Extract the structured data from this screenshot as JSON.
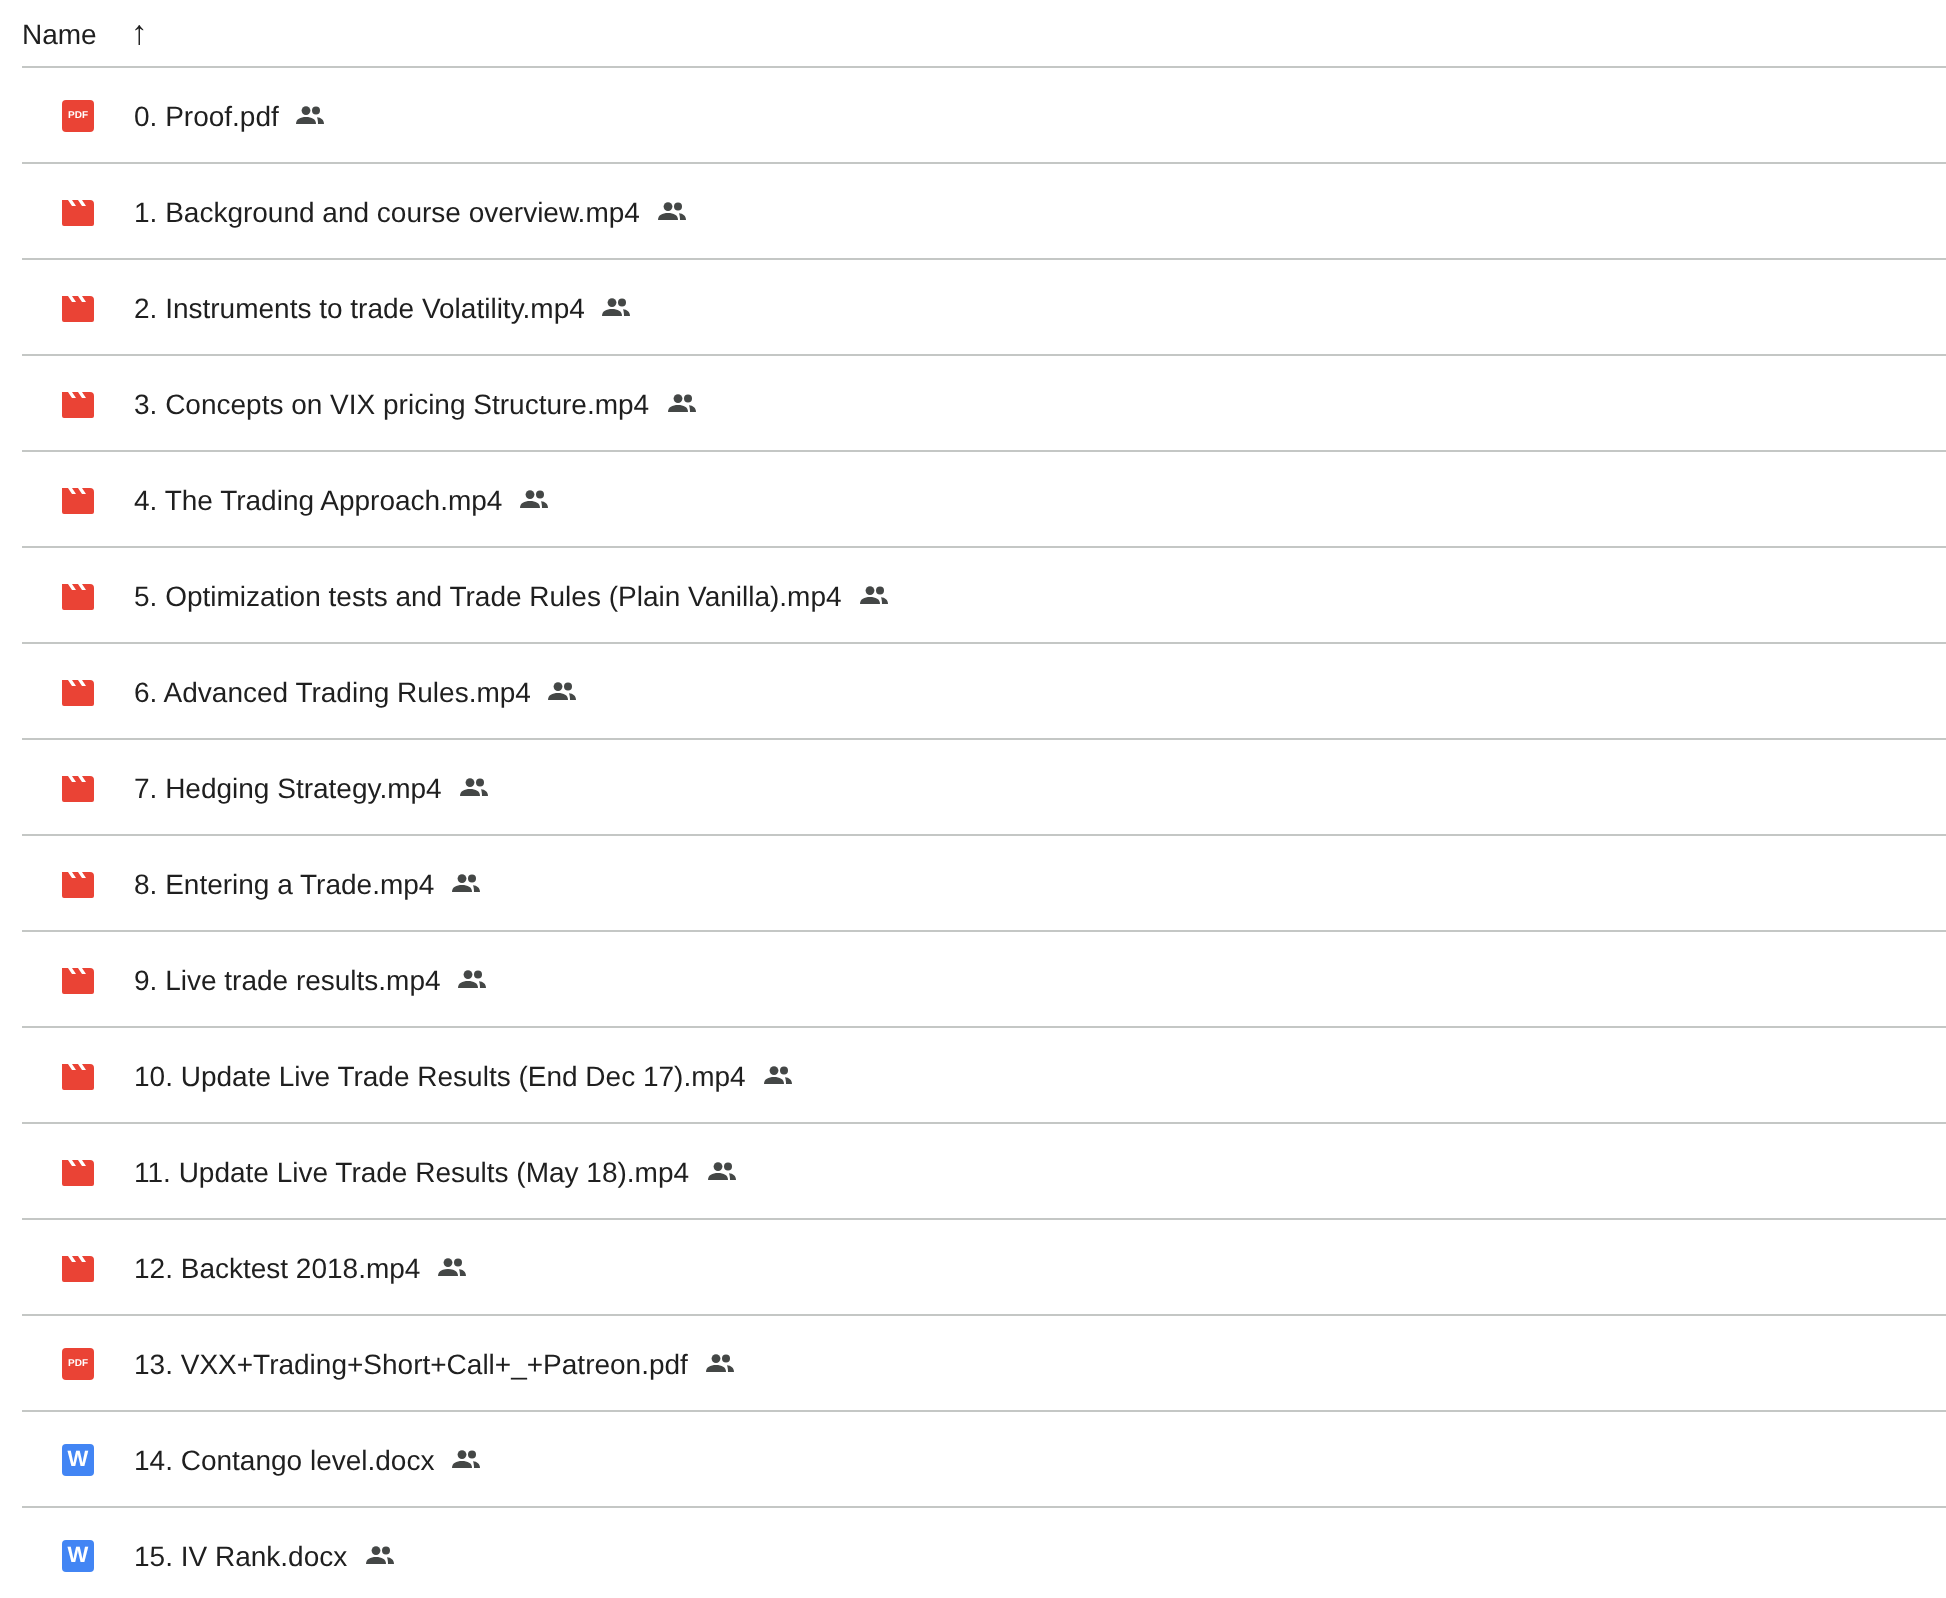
{
  "header": {
    "label": "Name",
    "sort_arrow": "↑"
  },
  "files": [
    {
      "kind": "pdf",
      "badge": "PDF",
      "name": "0. Proof.pdf",
      "shared": true
    },
    {
      "kind": "video",
      "name": "1. Background and course overview.mp4",
      "shared": true
    },
    {
      "kind": "video",
      "name": "2. Instruments to trade Volatility.mp4",
      "shared": true
    },
    {
      "kind": "video",
      "name": "3. Concepts on VIX pricing Structure.mp4",
      "shared": true
    },
    {
      "kind": "video",
      "name": "4. The Trading Approach.mp4",
      "shared": true
    },
    {
      "kind": "video",
      "name": "5. Optimization tests and Trade Rules (Plain Vanilla).mp4",
      "shared": true
    },
    {
      "kind": "video",
      "name": "6. Advanced Trading Rules.mp4",
      "shared": true
    },
    {
      "kind": "video",
      "name": "7. Hedging Strategy.mp4",
      "shared": true
    },
    {
      "kind": "video",
      "name": "8. Entering a Trade.mp4",
      "shared": true
    },
    {
      "kind": "video",
      "name": "9. Live trade results.mp4",
      "shared": true
    },
    {
      "kind": "video",
      "name": "10. Update Live Trade Results (End Dec 17).mp4",
      "shared": true
    },
    {
      "kind": "video",
      "name": "11. Update Live Trade Results (May 18).mp4",
      "shared": true
    },
    {
      "kind": "video",
      "name": "12. Backtest 2018.mp4",
      "shared": true
    },
    {
      "kind": "pdf",
      "badge": "PDF",
      "name": "13. VXX+Trading+Short+Call+_+Patreon.pdf",
      "shared": true
    },
    {
      "kind": "doc",
      "badge": "W",
      "name": "14. Contango level.docx",
      "shared": true
    },
    {
      "kind": "doc",
      "badge": "W",
      "name": "15. IV Rank.docx",
      "shared": true
    }
  ]
}
